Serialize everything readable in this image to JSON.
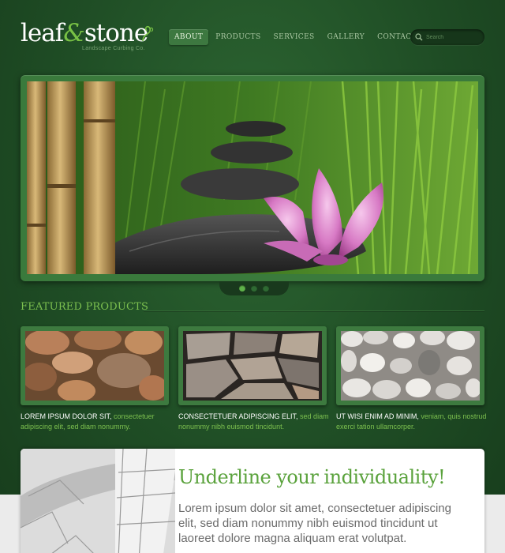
{
  "brand": {
    "logo_part1": "leaf",
    "logo_amp": "&",
    "logo_part2": "stone",
    "tagline": "Landscape Curbing Co."
  },
  "nav": {
    "items": [
      {
        "label": "ABOUT",
        "active": true
      },
      {
        "label": "PRODUCTS",
        "active": false
      },
      {
        "label": "SERVICES",
        "active": false
      },
      {
        "label": "GALLERY",
        "active": false
      },
      {
        "label": "CONTACTS",
        "active": false
      }
    ]
  },
  "search": {
    "placeholder": "Search",
    "value": ""
  },
  "slider": {
    "dots": 3,
    "active_dot": 0
  },
  "featured": {
    "title": "FEATURED PRODUCTS",
    "products": [
      {
        "image": "cobblestone-wall",
        "head": "LOREM IPSUM DOLOR SIT,",
        "body": "consectetuer adipiscing elit, sed diam nonummy."
      },
      {
        "image": "flagstone-pavement",
        "head": "CONSECTETUER ADIPISCING ELIT,",
        "body": "sed diam nonummy nibh euismod tincidunt."
      },
      {
        "image": "white-pebbles",
        "head": "UT WISI ENIM AD MINIM,",
        "body": "veniam, quis nostrud exerci tation ullamcorper."
      }
    ]
  },
  "promo": {
    "title": "Underline your individuality!",
    "body": "Lorem ipsum dolor sit amet, consectetuer adipiscing elit, sed diam nonummy nibh euismod tincidunt ut laoreet dolore magna aliquam erat volutpat."
  },
  "colors": {
    "background": "#1f4d25",
    "accent_green": "#7cc04f",
    "frame_green": "#3a7a3c",
    "nav_active": "#3d7840"
  }
}
